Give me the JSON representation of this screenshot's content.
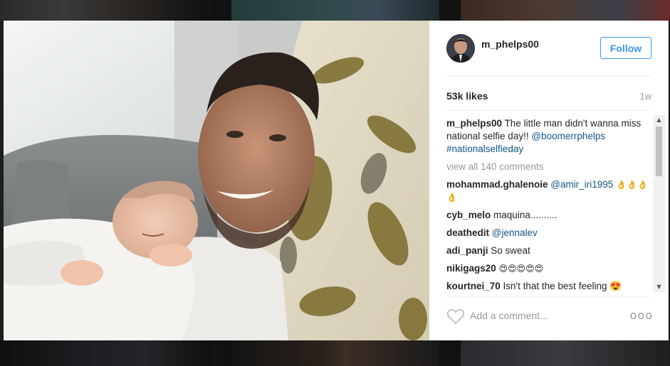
{
  "post": {
    "username": "m_phelps00",
    "follow_label": "Follow",
    "likes": "53k likes",
    "time": "1w",
    "caption_user": "m_phelps00",
    "caption_text": "The little man didn't wanna miss national selfie day!!",
    "caption_mention": "@boomerrphelps",
    "caption_hashtag": "#nationalselfieday",
    "view_all": "view all 140 comments"
  },
  "comments": [
    {
      "user": "mohammad.ghalenoie",
      "mention": "@amir_iri1995",
      "text": "👌👌👌👌"
    },
    {
      "user": "cyb_melo",
      "mention": "",
      "text": "maquina.........."
    },
    {
      "user": "deathedit",
      "mention": "@jennalev",
      "text": ""
    },
    {
      "user": "adi_panji",
      "mention": "",
      "text": "So sweat"
    },
    {
      "user": "nikigags20",
      "mention": "",
      "text": "😍😍😍😍😍"
    },
    {
      "user": "kourtnei_70",
      "mention": "",
      "text": "Isn't that the best feeling 😍"
    }
  ],
  "comment_box": {
    "placeholder": "Add a comment...",
    "more_label": "ooo"
  },
  "icons": {
    "like": "heart-outline-icon",
    "more": "more-options-icon"
  },
  "colors": {
    "accent": "#3897f0",
    "link": "#125688",
    "muted": "#999999"
  }
}
